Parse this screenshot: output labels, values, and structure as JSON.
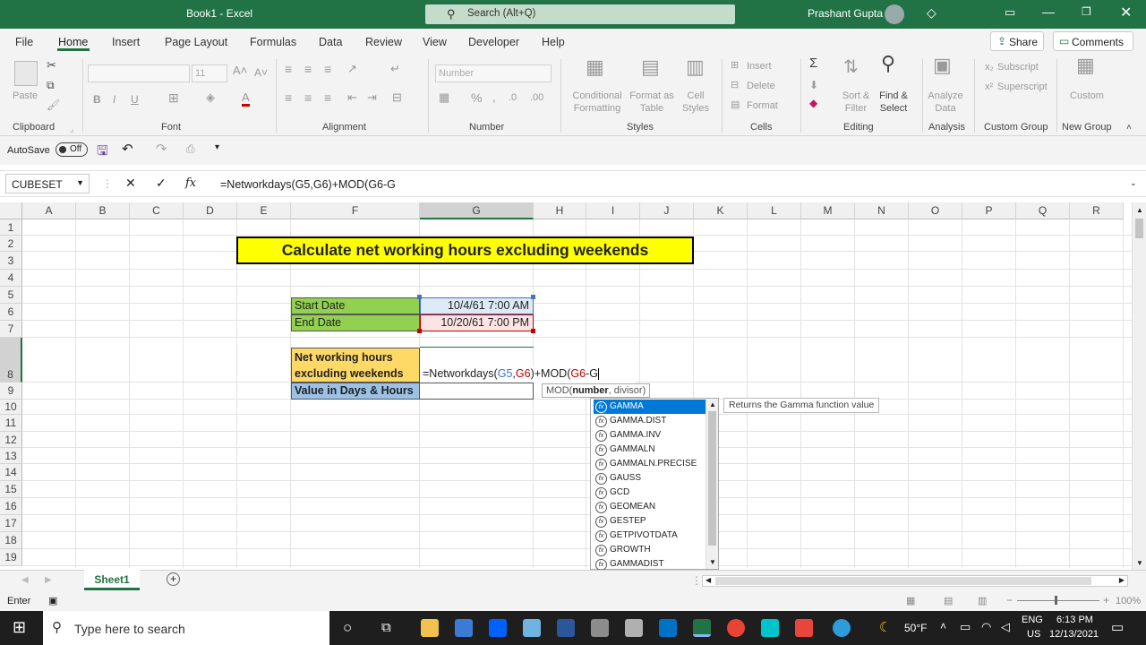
{
  "titlebar": {
    "doc_title": "Book1 - Excel",
    "search_placeholder": "Search (Alt+Q)",
    "user_name": "Prashant Gupta"
  },
  "menu": {
    "items": [
      "File",
      "Home",
      "Insert",
      "Page Layout",
      "Formulas",
      "Data",
      "Review",
      "View",
      "Developer",
      "Help"
    ],
    "share": "Share",
    "comments": "Comments"
  },
  "ribbon": {
    "groups": {
      "clipboard": "Clipboard",
      "font": "Font",
      "alignment": "Alignment",
      "number": "Number",
      "styles": "Styles",
      "cells": "Cells",
      "editing": "Editing",
      "analysis": "Analysis",
      "custom_group": "Custom Group",
      "new_group": "New Group"
    },
    "paste": "Paste",
    "font_size": "11",
    "number_format": "Number",
    "conditional_formatting": "Conditional Formatting",
    "format_as_table": "Format as Table",
    "cell_styles": "Cell Styles",
    "insert": "Insert",
    "delete": "Delete",
    "format": "Format",
    "sort_filter": "Sort & Filter",
    "find_select": "Find & Select",
    "analyze_data": "Analyze Data",
    "subscript": "Subscript",
    "superscript": "Superscript",
    "custom": "Custom"
  },
  "qat": {
    "autosave_label": "AutoSave",
    "autosave_state": "Off"
  },
  "formula_bar": {
    "name_box": "CUBESET",
    "formula": "=Networkdays(G5,G6)+MOD(G6-G"
  },
  "columns": [
    "A",
    "B",
    "C",
    "D",
    "E",
    "F",
    "G",
    "H",
    "I",
    "J",
    "K",
    "L",
    "M",
    "N",
    "O",
    "P",
    "Q",
    "R"
  ],
  "rows": [
    "1",
    "2",
    "3",
    "4",
    "5",
    "6",
    "7",
    "8",
    "9",
    "10",
    "11",
    "12",
    "13",
    "14",
    "15",
    "16",
    "17",
    "18",
    "19"
  ],
  "cells": {
    "title": "Calculate net working hours excluding weekends",
    "start_date_label": "Start Date",
    "start_date_value": "10/4/61 7:00 AM",
    "end_date_label": "End Date",
    "end_date_value": "10/20/61 7:00 PM",
    "net_hours_label_1": "Net working hours",
    "net_hours_label_2": "excluding weekends",
    "value_label": "Value in Days & Hours",
    "editing_formula_prefix": "=Networkdays(",
    "editing_ref_g5": "G5",
    "editing_comma": ",",
    "editing_ref_g6": "G6",
    "editing_mid": ")+MOD(",
    "editing_ref_g6b": "G6",
    "editing_tail": "-G"
  },
  "tooltip": {
    "mod_fn": "MOD(",
    "mod_args_bold": "number",
    ", divisor)": ", divisor)",
    "gamma_desc": "Returns the Gamma function value"
  },
  "autocomplete": {
    "items": [
      "GAMMA",
      "GAMMA.DIST",
      "GAMMA.INV",
      "GAMMALN",
      "GAMMALN.PRECISE",
      "GAUSS",
      "GCD",
      "GEOMEAN",
      "GESTEP",
      "GETPIVOTDATA",
      "GROWTH",
      "GAMMADIST"
    ],
    "selected": 0
  },
  "sheet_tabs": {
    "active": "Sheet1"
  },
  "status": {
    "mode": "Enter",
    "zoom": "100%"
  },
  "taskbar": {
    "search_placeholder": "Type here to search",
    "weather": "50°F",
    "language": "ENG",
    "region": "US",
    "time": "6:13 PM",
    "date": "12/13/2021"
  },
  "colors": {
    "excel_green": "#217346",
    "title_yellow": "#ffff00",
    "label_green": "#92d050",
    "label_orange": "#ffd966",
    "label_blue": "#9bc2e6",
    "start_bg": "#ddebf7",
    "end_bg": "#fce4e4"
  }
}
